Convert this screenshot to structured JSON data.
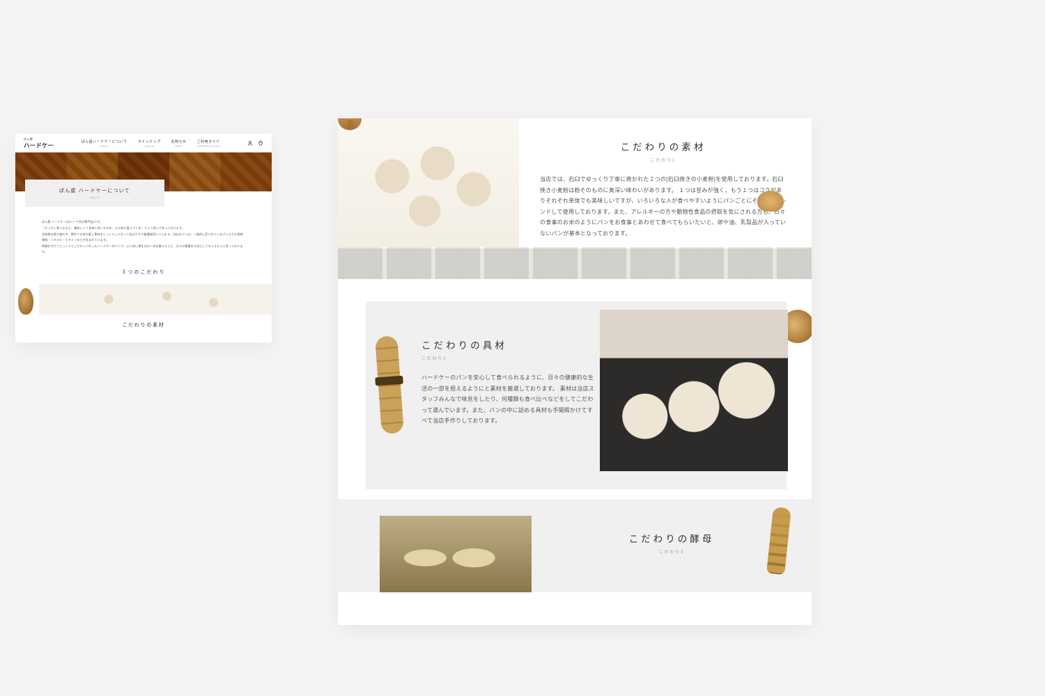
{
  "left": {
    "logo_small": "ぱん屋",
    "logo_main": "ハードケー",
    "nav": [
      {
        "jp": "ぱん屋ハードケーについて",
        "en": "ABOUT"
      },
      {
        "jp": "ラインナップ",
        "en": "LINE UP"
      },
      {
        "jp": "お知らせ",
        "en": "NEWS"
      },
      {
        "jp": "ご利用ガイド",
        "en": "SHOPPING GUIDE"
      }
    ],
    "page_title_jp": "ぱん屋 ハードケーについて",
    "page_title_en": "ABOUT",
    "intro": [
      "ぱん屋 ハードケーは[ハード系の専門店]です。",
      "「せっかく食べるなら、美味しくて身体に良いものを。心も体も喜ぶパンを」という思いで作っております。",
      "添加物は極力使わず、素朴でも味も最上素材をじっくりこだわって自分たちで厳選使用しています。当店のパンは、一般的に売られているパンよりも食物繊維・ミネラル・ビタミンなどが含まれています。",
      "時間をかけてじっくりとこだわって作ったハードケーのパンで、より良い食生活の一歩を携えたらと、日々の健康を大切にしてもらえたらと思っております。"
    ],
    "three_title": "３つのこだわり",
    "sec1_heading_preview": "こだわりの素材"
  },
  "right": {
    "section1": {
      "heading": "こだわりの素材",
      "sub": "こだわり1",
      "body": "当店では、石臼でゆっくり丁寧に挽かれた２つの[石臼挽きの小麦粉]を使用しております。石臼挽き小麦粉は粉そのものに奥深い味わいがあります。\n１つは甘みが強く、もう１つはコクがありそれぞれ単体でも美味しいですが、いろいろな人が食べやすいようにパンごとにそれぞれブレンドして使用しております。また、アレルギーの方や動物性食品の摂取を気にされる方も、日々の食事のお米のようにパンをお食事とあわせて食べてもらいたいと、卵や油、乳製品が入っていないパンが基本となっております。"
    },
    "section2": {
      "heading": "こだわりの具材",
      "sub": "こだわり2",
      "body": "ハードケーのパンを安心して食べられるように、日々の健康的な生活の一部を担えるようにと素材を厳選しております。\n素材は当店スタッフみんなで味見をしたり、何種類も食べ比べなどをしてこだわって選んでいます。また、パンの中に詰める具材も手間暇かけてすべて当店手作りしております。"
    },
    "section3": {
      "heading": "こだわりの酵母",
      "sub": "こだわり3"
    }
  }
}
